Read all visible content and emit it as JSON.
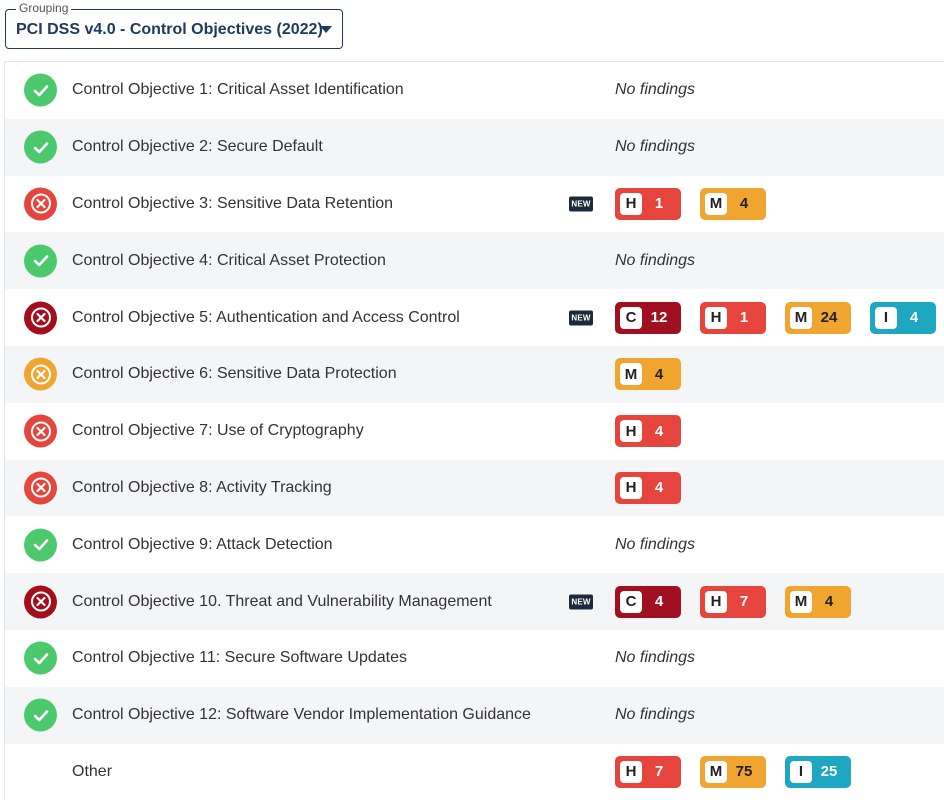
{
  "grouping": {
    "legend": "Grouping",
    "value": "PCI DSS v4.0 - Control Objectives (2022)"
  },
  "colors": {
    "pass": "#4cc96c",
    "fail_high": "#e5453d",
    "fail_critical": "#a40e1c",
    "fail_medium": "#f0a530",
    "critical": "#a11020",
    "high": "#e5453d",
    "medium": "#f0a530",
    "info": "#1ea7c0",
    "grouping_accent": "#1f3a60"
  },
  "rows": [
    {
      "label": "Control Objective 1: Critical Asset Identification",
      "status": "pass",
      "status_icon": "check-circle-icon",
      "no_findings": "No findings"
    },
    {
      "label": "Control Objective 2: Secure Default",
      "status": "pass",
      "status_icon": "check-circle-icon",
      "no_findings": "No findings"
    },
    {
      "label": "Control Objective 3: Sensitive Data Retention",
      "status": "fail",
      "status_icon": "x-circle-icon",
      "new": "NEW",
      "badges": [
        {
          "sev": "H",
          "count": "1"
        },
        {
          "sev": "M",
          "count": "4"
        }
      ]
    },
    {
      "label": "Control Objective 4: Critical Asset Protection",
      "status": "pass",
      "status_icon": "check-circle-icon",
      "no_findings": "No findings"
    },
    {
      "label": "Control Objective 5: Authentication and Access Control",
      "status": "critical",
      "status_icon": "x-circle-icon",
      "new": "NEW",
      "badges": [
        {
          "sev": "C",
          "count": "12"
        },
        {
          "sev": "H",
          "count": "1"
        },
        {
          "sev": "M",
          "count": "24"
        },
        {
          "sev": "I",
          "count": "4"
        }
      ]
    },
    {
      "label": "Control Objective 6: Sensitive Data Protection",
      "status": "medium",
      "status_icon": "x-circle-icon",
      "badges": [
        {
          "sev": "M",
          "count": "4"
        }
      ]
    },
    {
      "label": "Control Objective 7: Use of Cryptography",
      "status": "fail",
      "status_icon": "x-circle-icon",
      "badges": [
        {
          "sev": "H",
          "count": "4"
        }
      ]
    },
    {
      "label": "Control Objective 8: Activity Tracking",
      "status": "fail",
      "status_icon": "x-circle-icon",
      "badges": [
        {
          "sev": "H",
          "count": "4"
        }
      ]
    },
    {
      "label": "Control Objective 9: Attack Detection",
      "status": "pass",
      "status_icon": "check-circle-icon",
      "no_findings": "No findings"
    },
    {
      "label": "Control Objective 10. Threat and Vulnerability Management",
      "status": "critical",
      "status_icon": "x-circle-icon",
      "new": "NEW",
      "badges": [
        {
          "sev": "C",
          "count": "4"
        },
        {
          "sev": "H",
          "count": "7"
        },
        {
          "sev": "M",
          "count": "4"
        }
      ]
    },
    {
      "label": "Control Objective 11: Secure Software Updates",
      "status": "pass",
      "status_icon": "check-circle-icon",
      "no_findings": "No findings"
    },
    {
      "label": "Control Objective 12: Software Vendor Implementation Guidance",
      "status": "pass",
      "status_icon": "check-circle-icon",
      "no_findings": "No findings"
    },
    {
      "label": "Other",
      "status": "none",
      "badges": [
        {
          "sev": "H",
          "count": "7"
        },
        {
          "sev": "M",
          "count": "75"
        },
        {
          "sev": "I",
          "count": "25"
        }
      ]
    }
  ]
}
